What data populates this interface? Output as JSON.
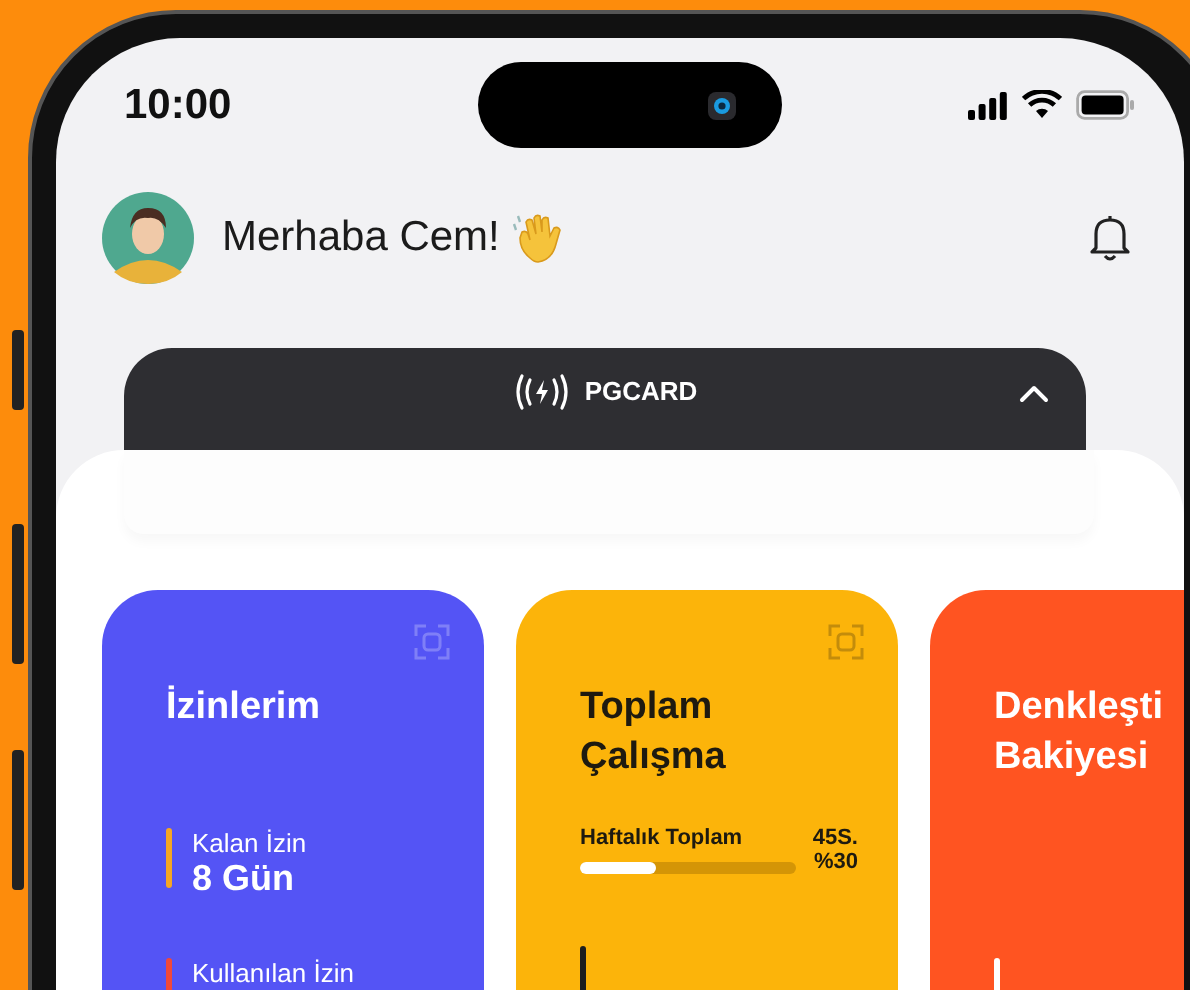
{
  "status_bar": {
    "time": "10:00"
  },
  "header": {
    "greeting": "Merhaba Cem!"
  },
  "card_bar": {
    "label": "PGCARD",
    "expanded": true
  },
  "cards": [
    {
      "kind": "leave",
      "color": "#5454f5",
      "title_lines": [
        "İzinlerim"
      ],
      "stats": [
        {
          "label": "Kalan İzin",
          "value": "8 Gün",
          "color": "#f5a623"
        },
        {
          "label": "Kullanılan İzin",
          "color": "#f0483a"
        }
      ]
    },
    {
      "kind": "work",
      "color": "#fcb40a",
      "title_lines": [
        "Toplam",
        "Çalışma"
      ],
      "weekly": {
        "label": "Haftalık Toplam",
        "hours": "45S.",
        "percent": "%30",
        "level": 0.35
      },
      "stats": [
        {
          "color": "#1e1e1e"
        }
      ]
    },
    {
      "kind": "balance",
      "color": "#ff5421",
      "title_lines": [
        "Denkleşti",
        "Bakiyesi"
      ],
      "stats": [
        {
          "color": "#ffffff"
        }
      ]
    }
  ]
}
